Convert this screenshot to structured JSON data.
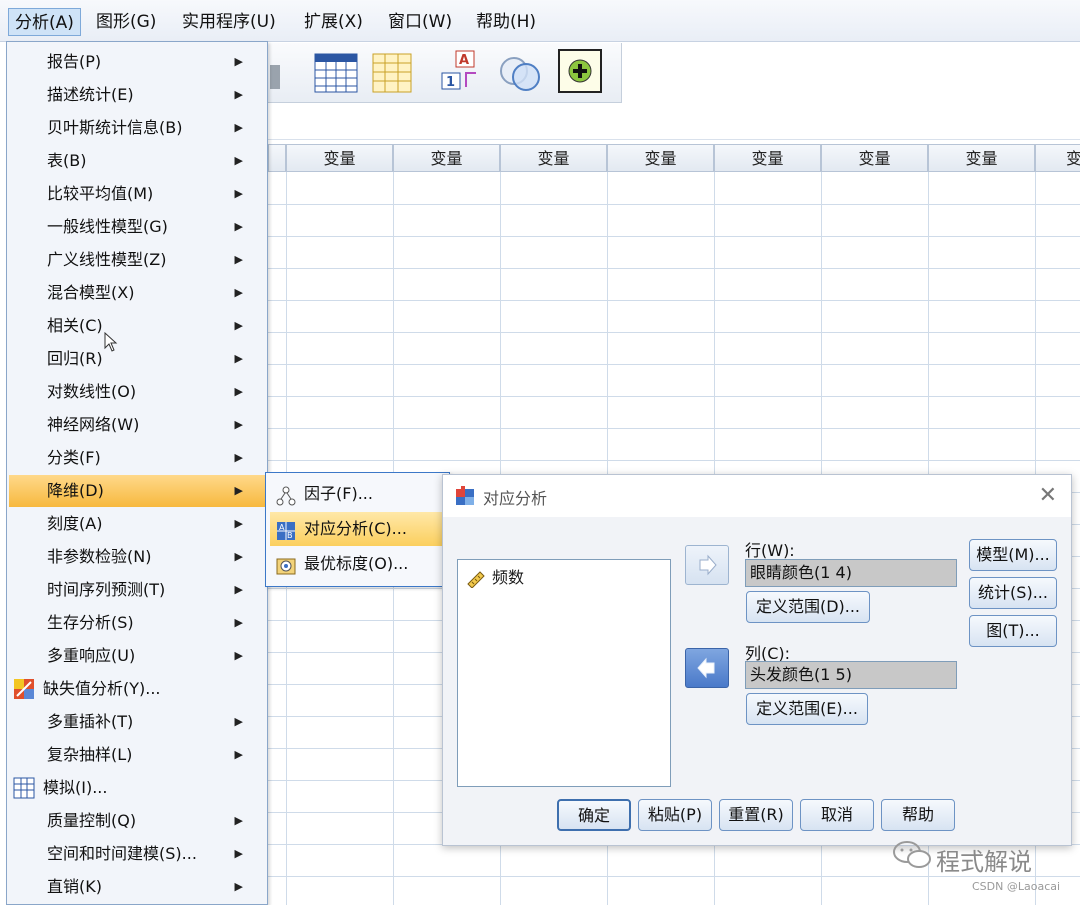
{
  "menubar": {
    "items": [
      "分析(A)",
      "图形(G)",
      "实用程序(U)",
      "扩展(X)",
      "窗口(W)",
      "帮助(H)"
    ],
    "active_index": 0
  },
  "grid": {
    "column_header": "变量",
    "partial_header": "变"
  },
  "analyze_menu": {
    "items": [
      {
        "label": "报告(P)",
        "submenu": true
      },
      {
        "label": "描述统计(E)",
        "submenu": true
      },
      {
        "label": "贝叶斯统计信息(B)",
        "submenu": true
      },
      {
        "label": "表(B)",
        "submenu": true
      },
      {
        "label": "比较平均值(M)",
        "submenu": true
      },
      {
        "label": "一般线性模型(G)",
        "submenu": true
      },
      {
        "label": "广义线性模型(Z)",
        "submenu": true
      },
      {
        "label": "混合模型(X)",
        "submenu": true
      },
      {
        "label": "相关(C)",
        "submenu": true
      },
      {
        "label": "回归(R)",
        "submenu": true
      },
      {
        "label": "对数线性(O)",
        "submenu": true
      },
      {
        "label": "神经网络(W)",
        "submenu": true
      },
      {
        "label": "分类(F)",
        "submenu": true
      },
      {
        "label": "降维(D)",
        "submenu": true,
        "highlight": true
      },
      {
        "label": "刻度(A)",
        "submenu": true
      },
      {
        "label": "非参数检验(N)",
        "submenu": true
      },
      {
        "label": "时间序列预测(T)",
        "submenu": true
      },
      {
        "label": "生存分析(S)",
        "submenu": true
      },
      {
        "label": "多重响应(U)",
        "submenu": true
      },
      {
        "label": "缺失值分析(Y)...",
        "submenu": false,
        "icon": "missing-value-icon"
      },
      {
        "label": "多重插补(T)",
        "submenu": true
      },
      {
        "label": "复杂抽样(L)",
        "submenu": true
      },
      {
        "label": "模拟(I)...",
        "submenu": false,
        "icon": "simulation-icon"
      },
      {
        "label": "质量控制(Q)",
        "submenu": true
      },
      {
        "label": "空间和时间建模(S)...",
        "submenu": true
      },
      {
        "label": "直销(K)",
        "submenu": true
      }
    ]
  },
  "dimreduce_submenu": {
    "items": [
      {
        "label": "因子(F)...",
        "icon": "factor-icon"
      },
      {
        "label": "对应分析(C)...",
        "icon": "correspondence-icon",
        "highlight": true
      },
      {
        "label": "最优标度(O)...",
        "icon": "optimal-scaling-icon"
      }
    ]
  },
  "dialog": {
    "title": "对应分析",
    "variable": "频数",
    "row_label": "行(W):",
    "row_value": "眼睛颜色(1 4)",
    "row_define": "定义范围(D)...",
    "col_label": "列(C):",
    "col_value": "头发颜色(1 5)",
    "col_define": "定义范围(E)...",
    "model_btn": "模型(M)...",
    "stats_btn": "统计(S)...",
    "plot_btn": "图(T)...",
    "ok_btn": "确定",
    "paste_btn": "粘贴(P)",
    "reset_btn": "重置(R)",
    "cancel_btn": "取消",
    "help_btn": "帮助"
  },
  "watermark": {
    "brand": "程式解说",
    "credit": "CSDN @Laoacai"
  }
}
